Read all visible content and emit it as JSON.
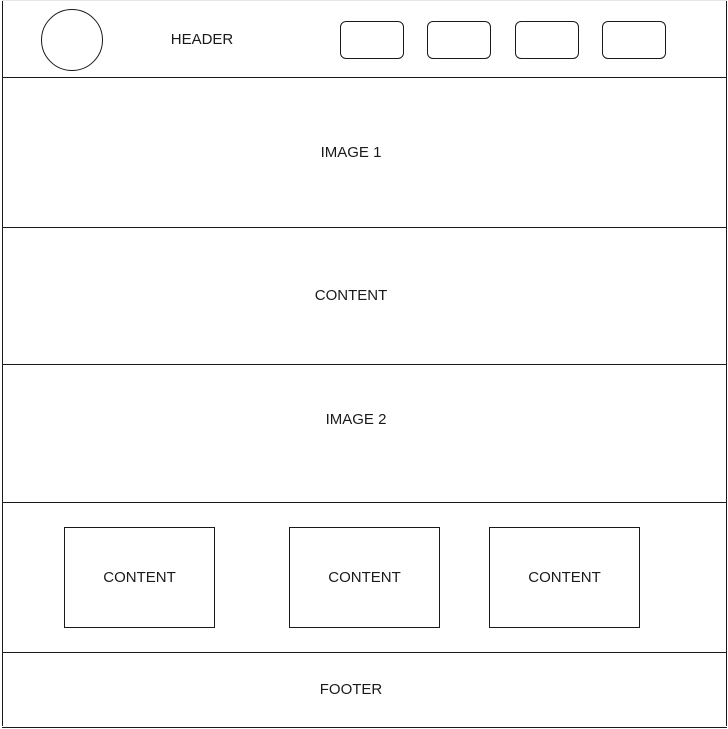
{
  "header": {
    "label": "HEADER",
    "nav_buttons": [
      "",
      "",
      "",
      ""
    ]
  },
  "image1": {
    "label": "IMAGE 1"
  },
  "content_main": {
    "label": "CONTENT"
  },
  "image2": {
    "label": "IMAGE 2"
  },
  "content_cards": [
    {
      "label": "CONTENT"
    },
    {
      "label": "CONTENT"
    },
    {
      "label": "CONTENT"
    }
  ],
  "footer": {
    "label": "FOOTER"
  }
}
